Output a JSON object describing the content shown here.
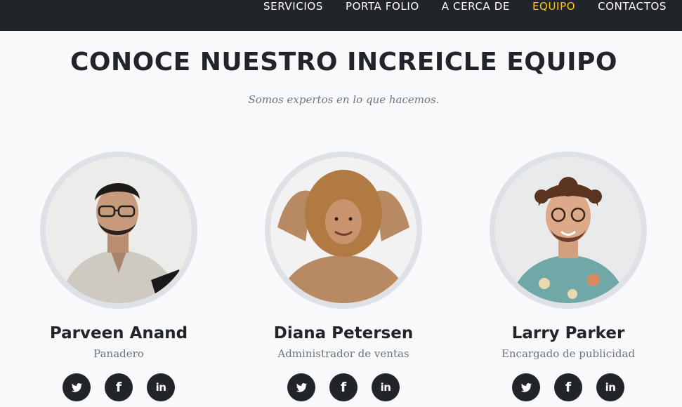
{
  "nav": {
    "items": [
      {
        "label": "SERVICIOS",
        "active": false
      },
      {
        "label": "PORTA FOLIO",
        "active": false
      },
      {
        "label": "A CERCA DE",
        "active": false
      },
      {
        "label": "EQUIPO",
        "active": true
      },
      {
        "label": "CONTACTOS",
        "active": false
      }
    ],
    "active_color": "#fec810"
  },
  "section": {
    "title": "CONOCE NUESTRO INCREICLE EQUIPO",
    "subtitle": "Somos expertos en lo que hacemos."
  },
  "team": [
    {
      "name": "Parveen Anand",
      "role": "Panadero",
      "photo": "portrait-photo",
      "socials": [
        "twitter-icon",
        "facebook-icon",
        "linkedin-icon"
      ]
    },
    {
      "name": "Diana Petersen",
      "role": "Administrador de ventas",
      "photo": "portrait-photo",
      "socials": [
        "twitter-icon",
        "facebook-icon",
        "linkedin-icon"
      ]
    },
    {
      "name": "Larry Parker",
      "role": "Encargado de publicidad",
      "photo": "portrait-photo",
      "socials": [
        "twitter-icon",
        "facebook-icon",
        "linkedin-icon"
      ]
    }
  ],
  "colors": {
    "navbar": "#212529",
    "background": "#f8f9fa",
    "text": "#212529",
    "muted": "#6c757d",
    "avatar_ring": "#dee2e6"
  }
}
